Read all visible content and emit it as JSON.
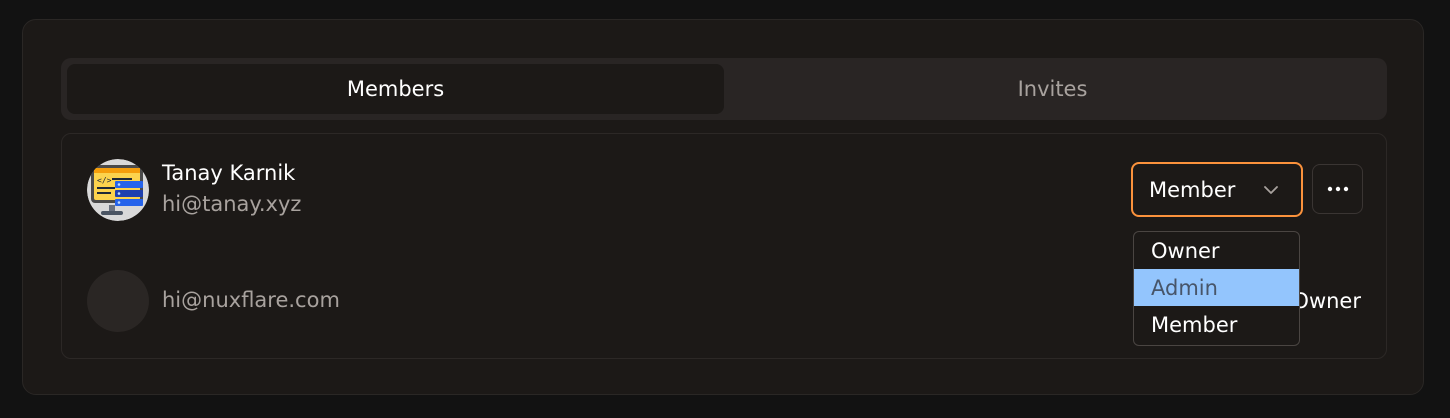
{
  "tabs": {
    "members": "Members",
    "invites": "Invites"
  },
  "members": [
    {
      "name": "Tanay Karnik",
      "email": "hi@tanay.xyz",
      "role_select": "Member"
    },
    {
      "name": "",
      "email": "hi@nuxflare.com",
      "role": "Owner"
    }
  ],
  "role_dropdown": {
    "options": [
      "Owner",
      "Admin",
      "Member"
    ],
    "highlighted": "Admin"
  },
  "colors": {
    "accent": "#fb923c",
    "highlight": "#93c5fd"
  },
  "icons": {
    "more": "more-horizontal-icon",
    "chevron": "chevron-down-icon",
    "avatar": "code-monitor-avatar"
  }
}
